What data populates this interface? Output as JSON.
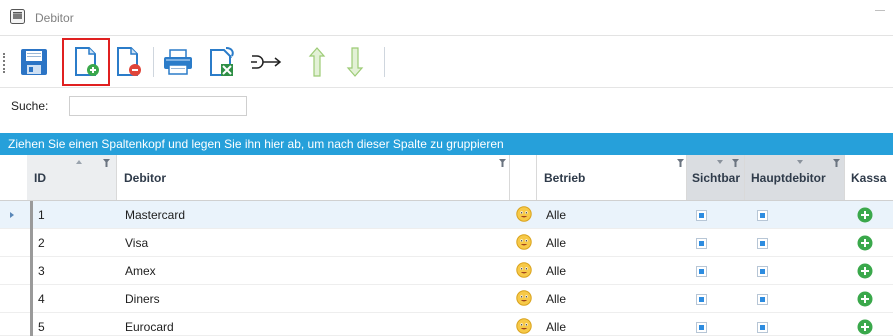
{
  "window": {
    "title": "Debitor",
    "app_icon": "app-window-icon"
  },
  "toolbar": {
    "buttons": [
      {
        "name": "save-icon",
        "tooltip": ""
      },
      {
        "name": "new-document-icon",
        "tooltip": ""
      },
      {
        "name": "delete-document-icon",
        "tooltip": ""
      },
      {
        "name": "print-icon",
        "tooltip": ""
      },
      {
        "name": "excel-export-icon",
        "tooltip": ""
      },
      {
        "name": "connect-icon",
        "tooltip": ""
      },
      {
        "name": "arrow-up-icon",
        "tooltip": ""
      },
      {
        "name": "arrow-down-icon",
        "tooltip": ""
      }
    ],
    "highlighted_button": "new-document-icon",
    "highlight_color": "#e02020"
  },
  "search": {
    "label": "Suche:",
    "value": ""
  },
  "group_panel": {
    "text": "Ziehen Sie einen Spaltenkopf und legen Sie ihn hier ab, um nach dieser Spalte zu gruppieren",
    "background": "#26a0da"
  },
  "grid": {
    "columns": {
      "id": "ID",
      "debitor": "Debitor",
      "emoji": "",
      "betrieb": "Betrieb",
      "sichtbar": "Sichtbar",
      "hauptdebitor": "Hauptdebitor",
      "kassa": "Kassa"
    },
    "rows": [
      {
        "id": "1",
        "debitor": "Mastercard",
        "betrieb": "Alle",
        "sichtbar": true,
        "hauptdebitor": true,
        "selected": true
      },
      {
        "id": "2",
        "debitor": "Visa",
        "betrieb": "Alle",
        "sichtbar": true,
        "hauptdebitor": true,
        "selected": false
      },
      {
        "id": "3",
        "debitor": "Amex",
        "betrieb": "Alle",
        "sichtbar": true,
        "hauptdebitor": true,
        "selected": false
      },
      {
        "id": "4",
        "debitor": "Diners",
        "betrieb": "Alle",
        "sichtbar": true,
        "hauptdebitor": true,
        "selected": false
      },
      {
        "id": "5",
        "debitor": "Eurocard",
        "betrieb": "Alle",
        "sichtbar": true,
        "hauptdebitor": true,
        "selected": false
      }
    ],
    "colors": {
      "selected_row": "#eaf3fb",
      "checkbox_fill": "#2d8ce0",
      "kassa_icon": "#3aa84b"
    }
  }
}
